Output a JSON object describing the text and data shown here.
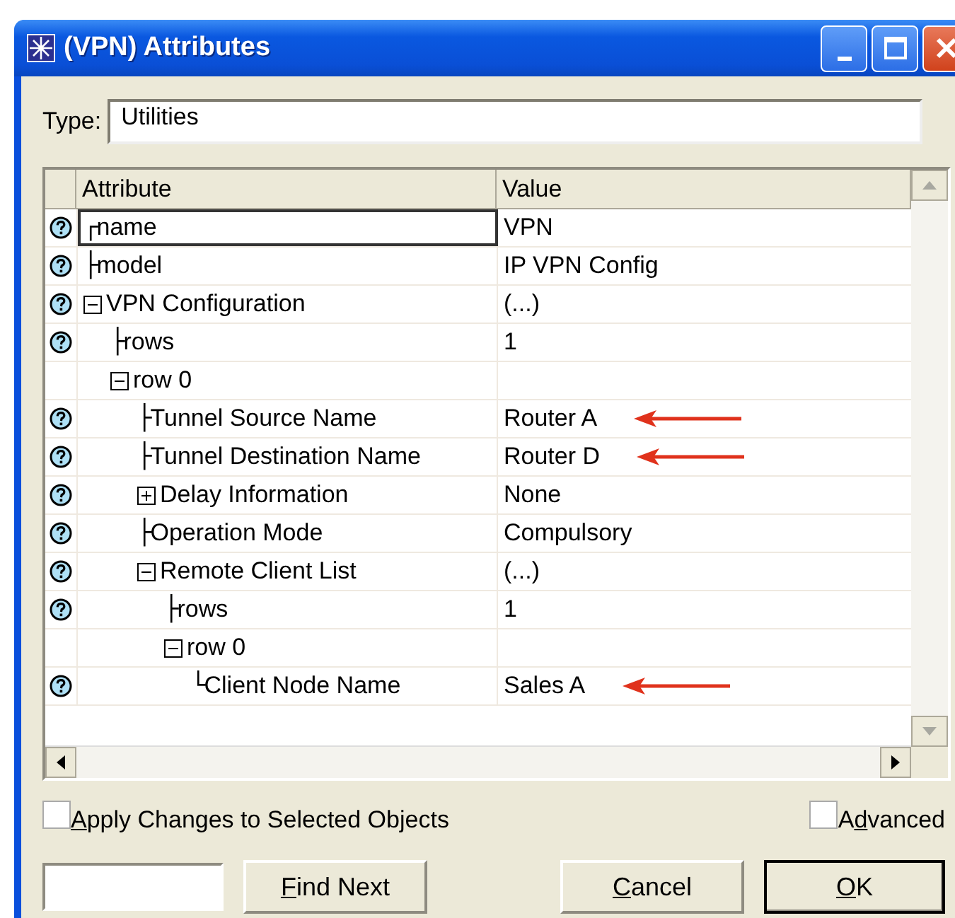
{
  "window": {
    "title": "(VPN) Attributes"
  },
  "type_field": {
    "label": "Type:",
    "value": "Utilities"
  },
  "table": {
    "columns": [
      "Attribute",
      "Value"
    ],
    "rows": [
      {
        "kind": "leaf",
        "connector": "┌",
        "label": "name",
        "value": "VPN",
        "help": true,
        "selected": true
      },
      {
        "kind": "leaf",
        "connector": "├",
        "label": "model",
        "value": "IP VPN Config",
        "help": true,
        "selected": false
      },
      {
        "kind": "group",
        "expanded": true,
        "label": "VPN Configuration",
        "value": "(...)",
        "help": true,
        "selected": false,
        "children": [
          {
            "kind": "leaf",
            "connector": "├",
            "label": "rows",
            "value": "1",
            "help": true,
            "selected": false
          },
          {
            "kind": "group",
            "expanded": true,
            "label": "row 0",
            "help": false,
            "selected": false,
            "children": [
              {
                "kind": "leaf",
                "connector": "├",
                "label": "Tunnel Source Name",
                "value": "Router A",
                "help": true,
                "selected": false,
                "arrow": true
              },
              {
                "kind": "leaf",
                "connector": "├",
                "label": "Tunnel Destination Name",
                "value": "Router D",
                "help": true,
                "selected": false,
                "arrow": true
              },
              {
                "kind": "group",
                "expanded": false,
                "label": "Delay Information",
                "value": "None",
                "help": true,
                "selected": false
              },
              {
                "kind": "leaf",
                "connector": "├",
                "label": "Operation Mode",
                "value": "Compulsory",
                "help": true,
                "selected": false
              },
              {
                "kind": "group",
                "expanded": true,
                "label": "Remote Client List",
                "value": "(...)",
                "help": true,
                "selected": false,
                "children": [
                  {
                    "kind": "leaf",
                    "connector": "├",
                    "label": "rows",
                    "value": "1",
                    "help": true,
                    "selected": false
                  },
                  {
                    "kind": "group",
                    "expanded": true,
                    "label": "row 0",
                    "help": false,
                    "selected": false,
                    "children": [
                      {
                        "kind": "leaf",
                        "connector": "└",
                        "label": "Client Node Name",
                        "value": "Sales A",
                        "help": true,
                        "selected": false,
                        "arrow": true
                      }
                    ]
                  }
                ]
              }
            ]
          }
        ]
      }
    ]
  },
  "checkboxes": [
    {
      "key": "A",
      "after": "pply Changes to Selected Objects",
      "checked": false
    },
    {
      "before": "A",
      "key": "d",
      "after": "vanced",
      "checked": false
    }
  ],
  "buttons": [
    {
      "kind": "find",
      "key": "F",
      "after": "ind Next",
      "default": false
    },
    {
      "kind": "cancel",
      "key": "C",
      "after": "ancel",
      "default": false
    },
    {
      "kind": "ok",
      "key": "O",
      "after": "K",
      "default": true
    }
  ]
}
